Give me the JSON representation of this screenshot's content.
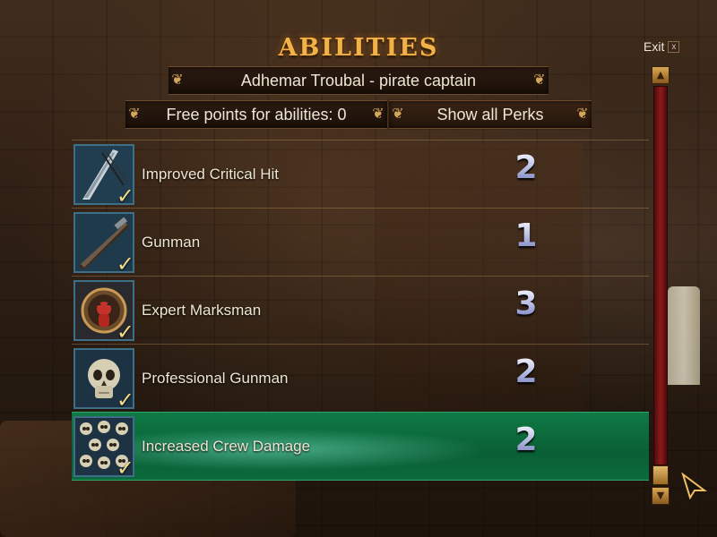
{
  "header": {
    "title": "ABILITIES",
    "exit_label": "Exit",
    "exit_close_glyph": "x"
  },
  "character": {
    "name_label": "Adhemar Troubal - pirate captain"
  },
  "points": {
    "label": "Free points for abilities: 0"
  },
  "perks_button": {
    "label": "Show all Perks"
  },
  "abilities": [
    {
      "name": "Improved Critical Hit",
      "level": "2",
      "icon": "sword-icon",
      "checked": true,
      "selected": false
    },
    {
      "name": "Gunman",
      "level": "1",
      "icon": "pistol-icon",
      "checked": true,
      "selected": false
    },
    {
      "name": "Expert Marksman",
      "level": "3",
      "icon": "target-icon",
      "checked": true,
      "selected": false
    },
    {
      "name": "Professional Gunman",
      "level": "2",
      "icon": "skull-icon",
      "checked": true,
      "selected": false
    },
    {
      "name": "Increased Crew Damage",
      "level": "2",
      "icon": "skulls-icon",
      "checked": true,
      "selected": true
    }
  ],
  "ornament_glyph": "❦",
  "check_glyph": "✓",
  "colors": {
    "title": "#f1b24a",
    "selected_row": "#0f7a45",
    "scroll_track": "#8e1a1a",
    "gold": "#d4a65a"
  }
}
